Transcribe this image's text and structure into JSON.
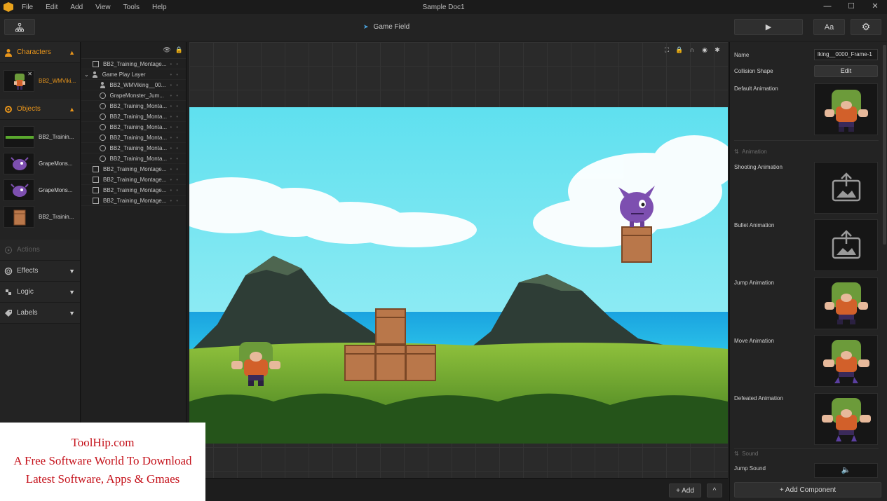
{
  "titlebar": {
    "menu": [
      "File",
      "Edit",
      "Add",
      "View",
      "Tools",
      "Help"
    ],
    "doc_title": "Sample Doc1",
    "controls": [
      "—",
      "☐",
      "✕"
    ]
  },
  "toolbar": {
    "center_label": "Game Field",
    "font_button": "Aa",
    "play_icon": "▶",
    "settings_icon": "⚙"
  },
  "left": {
    "characters_label": "Characters",
    "character_item": "BB2_WMViki...",
    "objects_label": "Objects",
    "objects": [
      "BB2_Trainin...",
      "GrapeMons...",
      "GrapeMons...",
      "BB2_Trainin..."
    ],
    "actions_label": "Actions",
    "effects_label": "Effects",
    "logic_label": "Logic",
    "labels_label": "Labels"
  },
  "layers": {
    "rows": [
      {
        "label": "BB2_Training_Montage...",
        "icon": "image",
        "indent": 0
      },
      {
        "label": "Game Play Layer",
        "icon": "person",
        "indent": 0,
        "caret": "⌄"
      },
      {
        "label": "BB2_WMViking__00...",
        "icon": "person",
        "indent": 1
      },
      {
        "label": "GrapeMonster_Jum...",
        "icon": "circle",
        "indent": 1
      },
      {
        "label": "BB2_Training_Monta...",
        "icon": "circle",
        "indent": 1
      },
      {
        "label": "BB2_Training_Monta...",
        "icon": "circle",
        "indent": 1
      },
      {
        "label": "BB2_Training_Monta...",
        "icon": "circle",
        "indent": 1
      },
      {
        "label": "BB2_Training_Monta...",
        "icon": "circle",
        "indent": 1
      },
      {
        "label": "BB2_Training_Monta...",
        "icon": "circle",
        "indent": 1
      },
      {
        "label": "BB2_Training_Monta...",
        "icon": "circle",
        "indent": 1
      },
      {
        "label": "BB2_Training_Montage...",
        "icon": "image",
        "indent": 0
      },
      {
        "label": "BB2_Training_Montage...",
        "icon": "image",
        "indent": 0
      },
      {
        "label": "BB2_Training_Montage...",
        "icon": "image",
        "indent": 0
      },
      {
        "label": "BB2_Training_Montage...",
        "icon": "image",
        "indent": 0
      }
    ]
  },
  "bottom": {
    "add_button": "+ Add",
    "collapse_icon": "^"
  },
  "inspector": {
    "name_label": "Name",
    "name_value": "lking__0000_Frame-1",
    "collision_label": "Collision Shape",
    "edit_button": "Edit",
    "default_anim_label": "Default Animation",
    "animation_section": "Animation",
    "shooting_label": "Shooting Animation",
    "bullet_label": "Bullet Animation",
    "jump_label": "Jump Animation",
    "move_label": "Move Animation",
    "defeated_label": "Defeated Animation",
    "sound_section": "Sound",
    "jump_sound_label": "Jump Sound",
    "add_component": "+ Add Component"
  },
  "watermark": {
    "line1": "ToolHip.com",
    "line2": "A Free Software World To Download",
    "line3": "Latest Software, Apps & Gmaes"
  },
  "colors": {
    "accent": "#e8951b",
    "panel": "#232323",
    "watermark_text": "#c5121b"
  }
}
